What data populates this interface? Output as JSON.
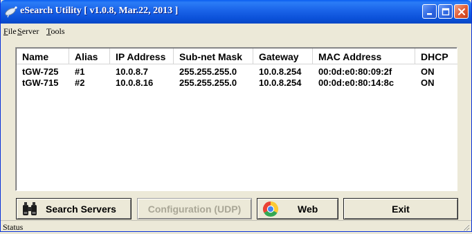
{
  "window": {
    "title": "eSearch Utility [ v1.0.8, Mar.22, 2013 ]",
    "icons": {
      "app": "satellite-icon",
      "minimize": "minimize-icon",
      "maximize": "maximize-icon",
      "close": "close-icon"
    }
  },
  "menu": {
    "items": [
      {
        "label": "File",
        "accel": "F",
        "rest": "ile"
      },
      {
        "label": "Server",
        "accel": "S",
        "rest": "erver"
      },
      {
        "label": "Tools",
        "accel": "T",
        "rest": "ools"
      }
    ]
  },
  "table": {
    "columns": [
      "Name",
      "Alias",
      "IP Address",
      "Sub-net Mask",
      "Gateway",
      "MAC Address",
      "DHCP"
    ],
    "rows": [
      [
        "tGW-725",
        "#1",
        "10.0.8.7",
        "255.255.255.0",
        "10.0.8.254",
        "00:0d:e0:80:09:2f",
        "ON"
      ],
      [
        "tGW-715",
        "#2",
        "10.0.8.16",
        "255.255.255.0",
        "10.0.8.254",
        "00:0d:e0:80:14:8c",
        "ON"
      ]
    ]
  },
  "buttons": {
    "search": {
      "label": "Search Servers",
      "icon": "binoculars-icon"
    },
    "config": {
      "label": "Configuration (UDP)",
      "enabled": false
    },
    "web": {
      "label": "Web",
      "icon": "chrome-icon"
    },
    "exit": {
      "label": "Exit"
    }
  },
  "status": {
    "text": "Status"
  },
  "colors": {
    "titlebar": "#0a5ef0",
    "window_bg": "#ece9d8",
    "close_button": "#e05a33"
  }
}
